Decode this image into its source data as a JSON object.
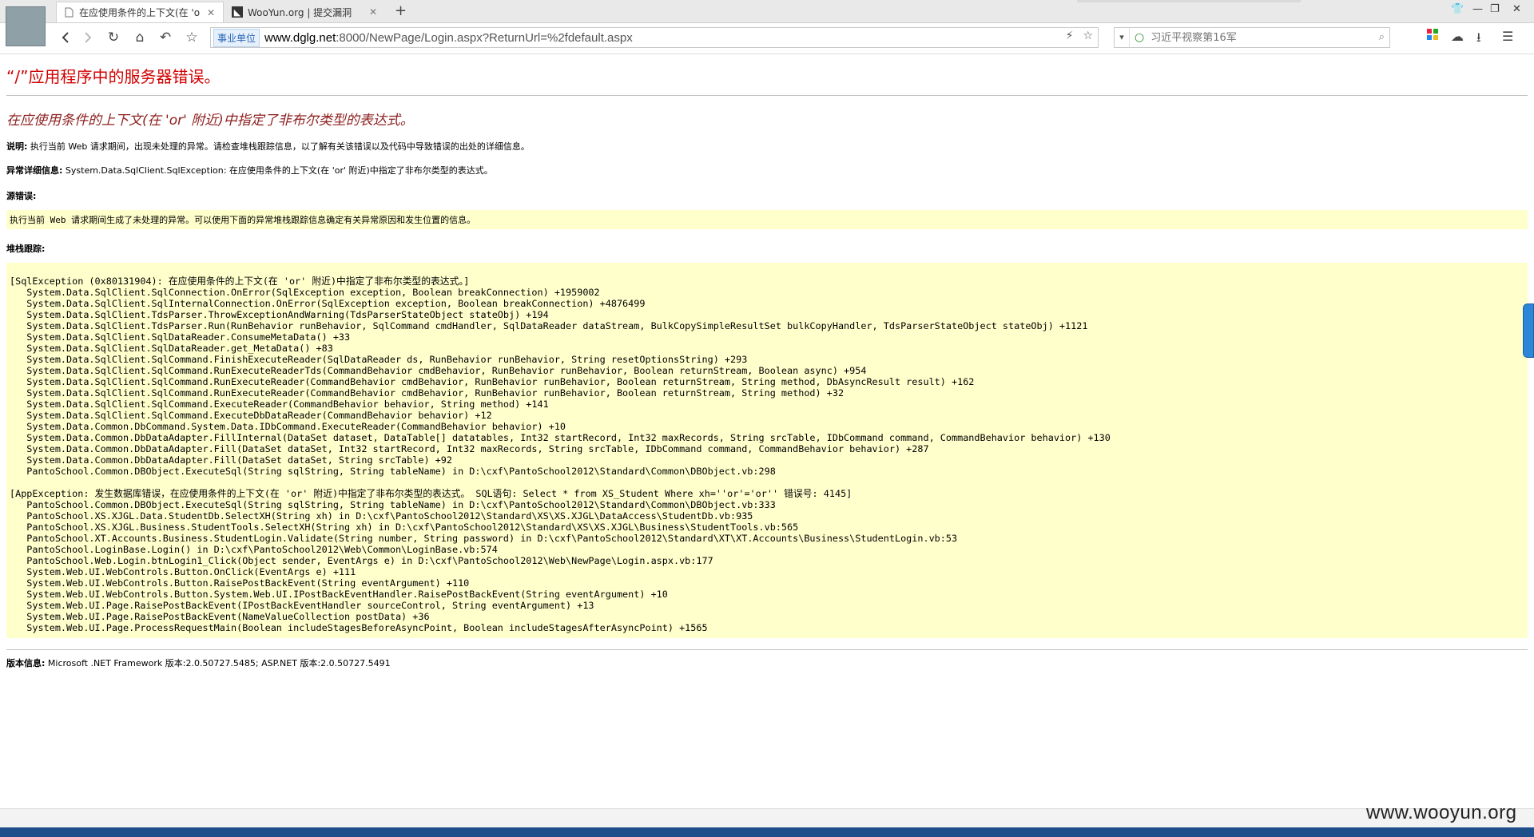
{
  "browser": {
    "tabs": [
      {
        "title": "在应使用条件的上下文(在 'o",
        "active": true
      },
      {
        "title": "WooYun.org | 提交漏洞",
        "active": false
      }
    ],
    "new_tab_symbol": "+",
    "address": {
      "badge": "事业单位",
      "host": "www.dglg.net",
      "rest": ":8000/NewPage/Login.aspx?ReturnUrl=%2fdefault.aspx"
    },
    "search_placeholder": "习近平视察第16军"
  },
  "page": {
    "title": "“/”应用程序中的服务器错误。",
    "subtitle": "在应使用条件的上下文(在 'or' 附近)中指定了非布尔类型的表达式。",
    "desc_label": "说明:",
    "desc_text": " 执行当前 Web 请求期间，出现未处理的异常。请检查堆栈跟踪信息，以了解有关该错误以及代码中导致错误的出处的详细信息。",
    "exception_label": "异常详细信息:",
    "exception_text": " System.Data.SqlClient.SqlException: 在应使用条件的上下文(在 'or' 附近)中指定了非布尔类型的表达式。",
    "source_label": "源错误:",
    "source_note": "执行当前 Web 请求期间生成了未处理的异常。可以使用下面的异常堆栈跟踪信息确定有关异常原因和发生位置的信息。",
    "stack_label": "堆栈跟踪:",
    "stack": [
      "[SqlException (0x80131904): 在应使用条件的上下文(在 'or' 附近)中指定了非布尔类型的表达式。]",
      "   System.Data.SqlClient.SqlConnection.OnError(SqlException exception, Boolean breakConnection) +1959002",
      "   System.Data.SqlClient.SqlInternalConnection.OnError(SqlException exception, Boolean breakConnection) +4876499",
      "   System.Data.SqlClient.TdsParser.ThrowExceptionAndWarning(TdsParserStateObject stateObj) +194",
      "   System.Data.SqlClient.TdsParser.Run(RunBehavior runBehavior, SqlCommand cmdHandler, SqlDataReader dataStream, BulkCopySimpleResultSet bulkCopyHandler, TdsParserStateObject stateObj) +1121",
      "   System.Data.SqlClient.SqlDataReader.ConsumeMetaData() +33",
      "   System.Data.SqlClient.SqlDataReader.get_MetaData() +83",
      "   System.Data.SqlClient.SqlCommand.FinishExecuteReader(SqlDataReader ds, RunBehavior runBehavior, String resetOptionsString) +293",
      "   System.Data.SqlClient.SqlCommand.RunExecuteReaderTds(CommandBehavior cmdBehavior, RunBehavior runBehavior, Boolean returnStream, Boolean async) +954",
      "   System.Data.SqlClient.SqlCommand.RunExecuteReader(CommandBehavior cmdBehavior, RunBehavior runBehavior, Boolean returnStream, String method, DbAsyncResult result) +162",
      "   System.Data.SqlClient.SqlCommand.RunExecuteReader(CommandBehavior cmdBehavior, RunBehavior runBehavior, Boolean returnStream, String method) +32",
      "   System.Data.SqlClient.SqlCommand.ExecuteReader(CommandBehavior behavior, String method) +141",
      "   System.Data.SqlClient.SqlCommand.ExecuteDbDataReader(CommandBehavior behavior) +12",
      "   System.Data.Common.DbCommand.System.Data.IDbCommand.ExecuteReader(CommandBehavior behavior) +10",
      "   System.Data.Common.DbDataAdapter.FillInternal(DataSet dataset, DataTable[] datatables, Int32 startRecord, Int32 maxRecords, String srcTable, IDbCommand command, CommandBehavior behavior) +130",
      "   System.Data.Common.DbDataAdapter.Fill(DataSet dataSet, Int32 startRecord, Int32 maxRecords, String srcTable, IDbCommand command, CommandBehavior behavior) +287",
      "   System.Data.Common.DbDataAdapter.Fill(DataSet dataSet, String srcTable) +92",
      "   PantoSchool.Common.DBObject.ExecuteSql(String sqlString, String tableName) in D:\\cxf\\PantoSchool2012\\Standard\\Common\\DBObject.vb:298",
      "",
      "[AppException: 发生数据库错误，在应使用条件的上下文(在 'or' 附近)中指定了非布尔类型的表达式。 SQL语句: Select * from XS_Student Where xh=''or'='or'' 错误号: 4145]",
      "   PantoSchool.Common.DBObject.ExecuteSql(String sqlString, String tableName) in D:\\cxf\\PantoSchool2012\\Standard\\Common\\DBObject.vb:333",
      "   PantoSchool.XS.XJGL.Data.StudentDb.SelectXH(String xh) in D:\\cxf\\PantoSchool2012\\Standard\\XS\\XS.XJGL\\DataAccess\\StudentDb.vb:935",
      "   PantoSchool.XS.XJGL.Business.StudentTools.SelectXH(String xh) in D:\\cxf\\PantoSchool2012\\Standard\\XS\\XS.XJGL\\Business\\StudentTools.vb:565",
      "   PantoSchool.XT.Accounts.Business.StudentLogin.Validate(String number, String password) in D:\\cxf\\PantoSchool2012\\Standard\\XT\\XT.Accounts\\Business\\StudentLogin.vb:53",
      "   PantoSchool.LoginBase.Login() in D:\\cxf\\PantoSchool2012\\Web\\Common\\LoginBase.vb:574",
      "   PantoSchool.Web.Login.btnLogin1_Click(Object sender, EventArgs e) in D:\\cxf\\PantoSchool2012\\Web\\NewPage\\Login.aspx.vb:177",
      "   System.Web.UI.WebControls.Button.OnClick(EventArgs e) +111",
      "   System.Web.UI.WebControls.Button.RaisePostBackEvent(String eventArgument) +110",
      "   System.Web.UI.WebControls.Button.System.Web.UI.IPostBackEventHandler.RaisePostBackEvent(String eventArgument) +10",
      "   System.Web.UI.Page.RaisePostBackEvent(IPostBackEventHandler sourceControl, String eventArgument) +13",
      "   System.Web.UI.Page.RaisePostBackEvent(NameValueCollection postData) +36",
      "   System.Web.UI.Page.ProcessRequestMain(Boolean includeStagesBeforeAsyncPoint, Boolean includeStagesAfterAsyncPoint) +1565"
    ],
    "version_label": "版本信息:",
    "version_text": " Microsoft .NET Framework 版本:2.0.50727.5485; ASP.NET 版本:2.0.50727.5491"
  },
  "watermark": "www.wooyun.org",
  "colors": {
    "error_title": "#d00000",
    "subtitle": "#8e2020",
    "box_bg": "#ffffcc"
  }
}
